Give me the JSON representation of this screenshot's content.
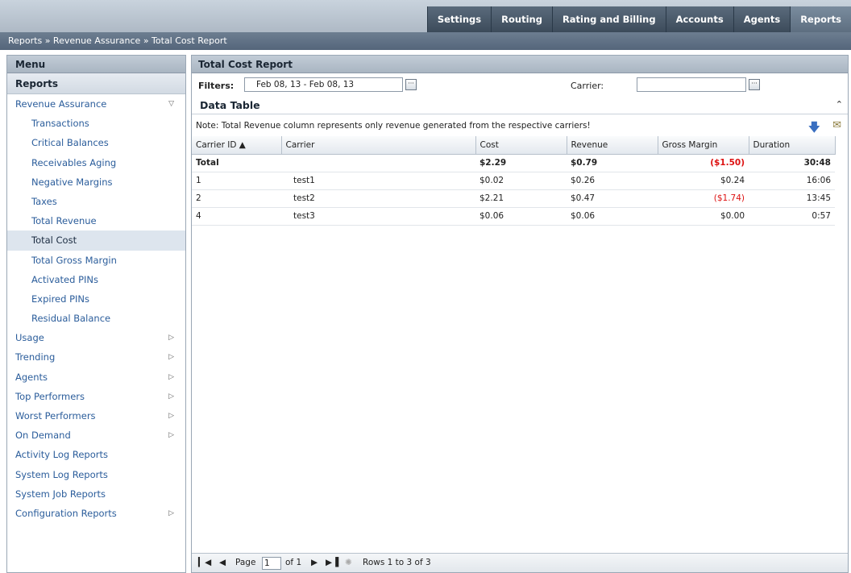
{
  "topnav": {
    "tabs": [
      {
        "label": "Settings",
        "active": false
      },
      {
        "label": "Routing",
        "active": false
      },
      {
        "label": "Rating and Billing",
        "active": false
      },
      {
        "label": "Accounts",
        "active": false
      },
      {
        "label": "Agents",
        "active": false
      },
      {
        "label": "Reports",
        "active": true
      }
    ]
  },
  "breadcrumb": "Reports » Revenue Assurance » Total Cost Report",
  "menu": {
    "title": "Menu",
    "section": "Reports",
    "items": [
      {
        "label": "Revenue Assurance",
        "level": "group",
        "arrow": "down"
      },
      {
        "label": "Transactions",
        "level": "sub"
      },
      {
        "label": "Critical Balances",
        "level": "sub"
      },
      {
        "label": "Receivables Aging",
        "level": "sub"
      },
      {
        "label": "Negative Margins",
        "level": "sub"
      },
      {
        "label": "Taxes",
        "level": "sub"
      },
      {
        "label": "Total Revenue",
        "level": "sub"
      },
      {
        "label": "Total Cost",
        "level": "sub",
        "selected": true
      },
      {
        "label": "Total Gross Margin",
        "level": "sub"
      },
      {
        "label": "Activated PINs",
        "level": "sub"
      },
      {
        "label": "Expired PINs",
        "level": "sub"
      },
      {
        "label": "Residual Balance",
        "level": "sub"
      },
      {
        "label": "Usage",
        "level": "group",
        "arrow": "right"
      },
      {
        "label": "Trending",
        "level": "group",
        "arrow": "right"
      },
      {
        "label": "Agents",
        "level": "group",
        "arrow": "right"
      },
      {
        "label": "Top Performers",
        "level": "group",
        "arrow": "right"
      },
      {
        "label": "Worst Performers",
        "level": "group",
        "arrow": "right"
      },
      {
        "label": "On Demand",
        "level": "group",
        "arrow": "right"
      },
      {
        "label": "Activity Log Reports",
        "level": "group"
      },
      {
        "label": "System Log Reports",
        "level": "group"
      },
      {
        "label": "System Job Reports",
        "level": "group"
      },
      {
        "label": "Configuration Reports",
        "level": "group",
        "arrow": "right"
      }
    ]
  },
  "main": {
    "title": "Total Cost Report",
    "filters_label": "Filters:",
    "date_range": "Feb 08, 13 - Feb 08, 13",
    "carrier_label": "Carrier:",
    "carrier_value": "",
    "data_table_title": "Data Table",
    "note": "Note: Total Revenue column represents only revenue generated from the respective carriers!",
    "columns": [
      "Carrier ID ▲",
      "Carrier",
      "Cost",
      "Revenue",
      "Gross Margin",
      "Duration"
    ],
    "total_row": {
      "id": "Total",
      "carrier": "",
      "cost": "$2.29",
      "revenue": "$0.79",
      "margin": "($1.50)",
      "duration": "30:48",
      "negative": true
    },
    "rows": [
      {
        "id": "1",
        "carrier": "test1",
        "cost": "$0.02",
        "revenue": "$0.26",
        "margin": "$0.24",
        "duration": "16:06",
        "negative": false
      },
      {
        "id": "2",
        "carrier": "test2",
        "cost": "$2.21",
        "revenue": "$0.47",
        "margin": "($1.74)",
        "duration": "13:45",
        "negative": true
      },
      {
        "id": "4",
        "carrier": "test3",
        "cost": "$0.06",
        "revenue": "$0.06",
        "margin": "$0.00",
        "duration": "0:57",
        "negative": false
      }
    ],
    "pager": {
      "page_label": "Page",
      "page": "1",
      "of": "of 1",
      "rows": "Rows  1  to 3  of 3"
    }
  },
  "colors": {
    "negative": "#dd1111",
    "link": "#2b5d9b",
    "nav": "#3c4b5a"
  }
}
